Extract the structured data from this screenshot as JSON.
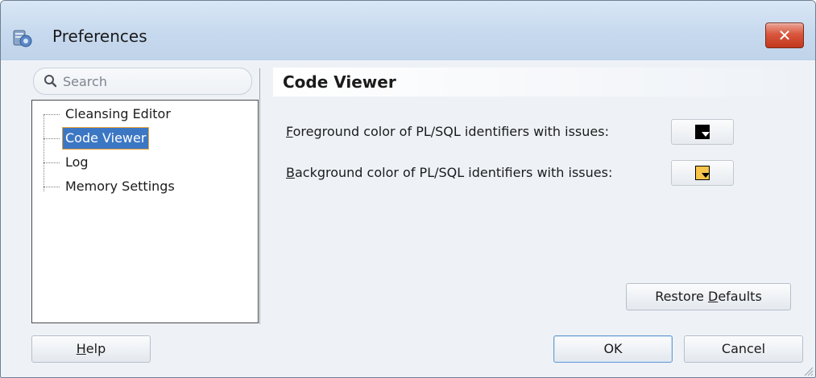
{
  "window": {
    "title": "Preferences",
    "close_label": "✕"
  },
  "search": {
    "placeholder": "Search"
  },
  "tree": {
    "items": [
      {
        "label": "Cleansing Editor",
        "selected": false
      },
      {
        "label": "Code Viewer",
        "selected": true
      },
      {
        "label": "Log",
        "selected": false
      },
      {
        "label": "Memory Settings",
        "selected": false
      }
    ]
  },
  "panel": {
    "title": "Code Viewer",
    "options": [
      {
        "mnemonic": "F",
        "rest": "oreground color of PL/SQL identifiers with issues:",
        "color": "#000000"
      },
      {
        "mnemonic": "B",
        "rest": "ackground color of PL/SQL identifiers with issues:",
        "color": "#f7c54a"
      }
    ],
    "restore_label_pre": "Restore ",
    "restore_mnemonic": "D",
    "restore_label_post": "efaults"
  },
  "footer": {
    "help_mnemonic": "H",
    "help_rest": "elp",
    "ok_label": "OK",
    "cancel_label": "Cancel"
  },
  "colors": {
    "selection": "#3c77c4",
    "focus_outline": "#e8a33a",
    "close_button": "#c2381d"
  },
  "icons": [
    "app-preferences-icon",
    "search-icon",
    "close-icon",
    "resize-grip-icon",
    "dropdown-arrow-icon"
  ]
}
